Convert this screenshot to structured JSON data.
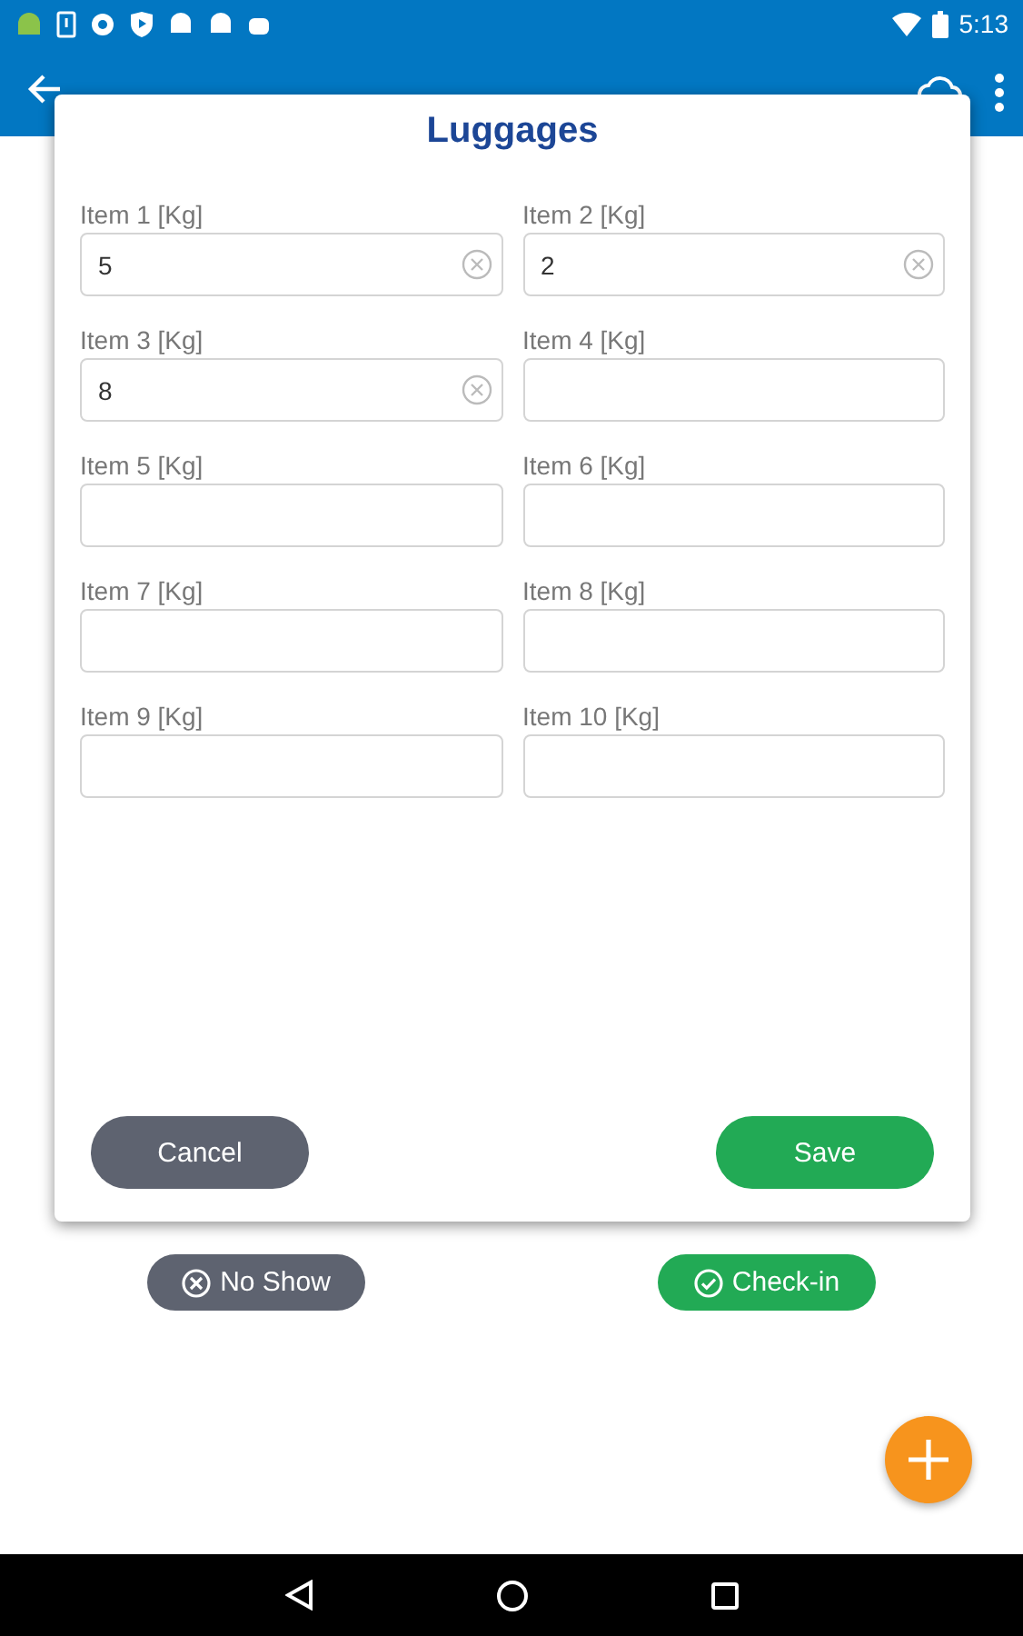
{
  "status_bar": {
    "time": "5:13"
  },
  "page_buttons": [
    {
      "label": "No Show",
      "kind": "cancel"
    },
    {
      "label": "Check-in",
      "kind": "confirm"
    }
  ],
  "dialog": {
    "title": "Luggages",
    "fields": [
      {
        "label": "Item 1 [Kg]",
        "value": "5"
      },
      {
        "label": "Item 2 [Kg]",
        "value": "2"
      },
      {
        "label": "Item 3 [Kg]",
        "value": "8"
      },
      {
        "label": "Item 4 [Kg]"
      },
      {
        "label": "Item 5 [Kg]"
      },
      {
        "label": "Item 6 [Kg]"
      },
      {
        "label": "Item 7 [Kg]"
      },
      {
        "label": "Item 8 [Kg]"
      },
      {
        "label": "Item 9 [Kg]"
      },
      {
        "label": "Item 10 [Kg]"
      }
    ],
    "buttons": [
      {
        "label": "Cancel",
        "kind": "cancel"
      },
      {
        "label": "Save",
        "kind": "confirm"
      }
    ]
  }
}
